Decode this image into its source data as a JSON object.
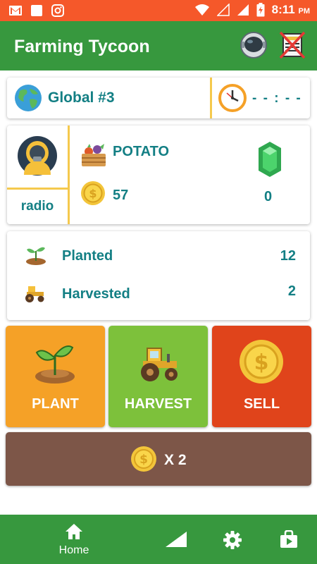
{
  "status_bar": {
    "time": "8:11",
    "ampm": "PM"
  },
  "app": {
    "title": "Farming Tycoon"
  },
  "global": {
    "label": "Global #3",
    "timer": "- - : - -"
  },
  "player": {
    "name": "radio",
    "crop": "POTATO",
    "coins": "57",
    "gems": "0"
  },
  "stats": [
    {
      "label": "Planted",
      "value": "12"
    },
    {
      "label": "Harvested",
      "value": "2"
    }
  ],
  "actions": {
    "plant": "PLANT",
    "harvest": "HARVEST",
    "sell": "SELL",
    "multiplier": "X 2"
  },
  "nav": {
    "home": "Home"
  },
  "colors": {
    "status_bar": "#f5582a",
    "primary": "#37983e",
    "teal_text": "#137f84",
    "divider": "#f5c94d",
    "plant": "#f5a127",
    "harvest": "#7dc13b",
    "sell": "#e0441b",
    "multiplier": "#7d5648"
  },
  "icons": {
    "gmail": "gmail-icon",
    "notification": "square-icon",
    "instagram": "instagram-icon",
    "wifi": "wifi-icon",
    "signal": "signal-icon",
    "battery": "battery-icon",
    "astronaut": "astronaut-icon",
    "no_ads": "no-ads-icon",
    "globe": "globe-icon",
    "clock": "clock-icon",
    "avatar": "hazmat-avatar-icon",
    "vegetables": "vegetable-crate-icon",
    "coin": "dollar-coin-icon",
    "gem": "emerald-gem-icon",
    "sprout": "sprout-icon",
    "tractor": "tractor-icon",
    "home": "home-icon",
    "stats": "stats-ramp-icon",
    "settings": "gear-icon",
    "shop": "shopping-bag-icon"
  }
}
